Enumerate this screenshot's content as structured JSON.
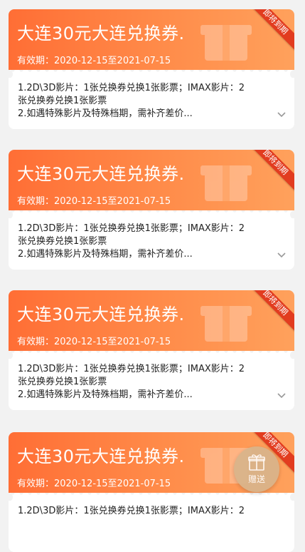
{
  "coupons": [
    {
      "title": "大连30元大连兑换券.",
      "validity": "有效期：2020-12-15至2021-07-15",
      "badge": "即将到期",
      "desc": [
        "1.2D\\3D影片：1张兑换券兑换1张影票；IMAX影片：2",
        "张兑换券兑换1张影票",
        "2.如遇特殊影片及特殊档期，需补齐差价..."
      ]
    },
    {
      "title": "大连30元大连兑换券.",
      "validity": "有效期：2020-12-15至2021-07-15",
      "badge": "即将到期",
      "desc": [
        "1.2D\\3D影片：1张兑换券兑换1张影票；IMAX影片：2",
        "张兑换券兑换1张影票",
        "2.如遇特殊影片及特殊档期，需补齐差价..."
      ]
    },
    {
      "title": "大连30元大连兑换券.",
      "validity": "有效期：2020-12-15至2021-07-15",
      "badge": "即将到期",
      "desc": [
        "1.2D\\3D影片：1张兑换券兑换1张影票；IMAX影片：2",
        "张兑换券兑换1张影票",
        "2.如遇特殊影片及特殊档期，需补齐差价..."
      ]
    },
    {
      "title": "大连30元大连兑换券.",
      "validity": "有效期：2020-12-15至2021-07-15",
      "badge": "即将到期",
      "desc": [
        "1.2D\\3D影片：1张兑换券兑换1张影票；IMAX影片：2",
        "",
        ""
      ]
    }
  ],
  "gift_button": {
    "label": "赠送",
    "icon": "gift-icon"
  },
  "colors": {
    "coupon_gradient_start": "#ff6e35",
    "coupon_gradient_end": "#ffa15c",
    "badge": "#e23c1f",
    "gift_button": "#d9b48b",
    "background": "#f2f2f2"
  }
}
